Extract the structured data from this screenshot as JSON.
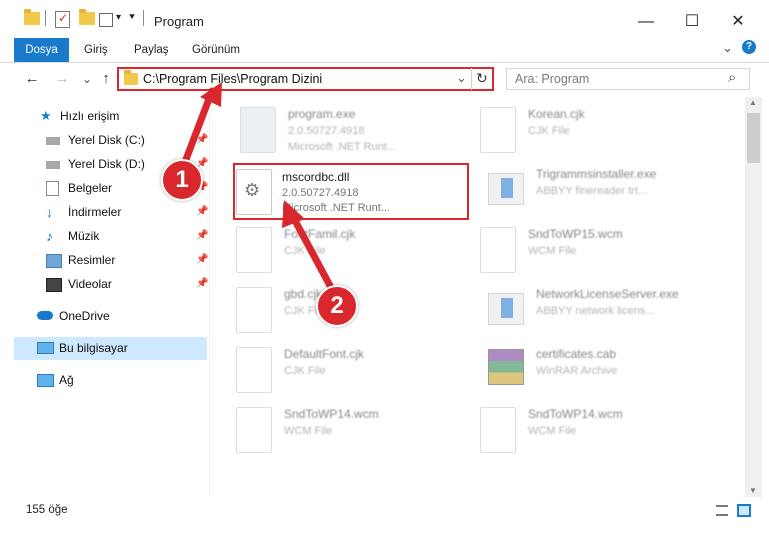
{
  "window": {
    "title": "Program",
    "minimize": "—",
    "maximize": "☐",
    "close": "✕"
  },
  "ribbon": {
    "tabs": [
      "Dosya",
      "Giriş",
      "Paylaş",
      "Görünüm"
    ],
    "expand": "⌄",
    "help": "?"
  },
  "nav": {
    "back": "←",
    "forward": "→",
    "recent": "⌄",
    "up": "↑",
    "address": "C:\\Program Files\\Program Dizini",
    "dropdown": "⌄",
    "refresh": "↻",
    "search_placeholder": "Ara: Program",
    "search_icon": "⌕"
  },
  "sidebar": {
    "quick_access": "Hızlı erişim",
    "items": [
      {
        "label": "Yerel Disk (C:)",
        "icon": "drive-icon",
        "pinned": true
      },
      {
        "label": "Yerel Disk (D:)",
        "icon": "drive-icon",
        "pinned": true
      },
      {
        "label": "Belgeler",
        "icon": "documents-icon",
        "pinned": true
      },
      {
        "label": "İndirmeler",
        "icon": "download-icon",
        "pinned": true
      },
      {
        "label": "Müzik",
        "icon": "music-icon",
        "pinned": true
      },
      {
        "label": "Resimler",
        "icon": "pictures-icon",
        "pinned": true
      },
      {
        "label": "Videolar",
        "icon": "videos-icon",
        "pinned": true
      }
    ],
    "onedrive": "OneDrive",
    "this_pc": "Bu bilgisayar",
    "network": "Ağ"
  },
  "files": [
    {
      "name": "program.exe",
      "line1": "2.0.50727.4918",
      "line2": "Microsoft .NET Runt...",
      "icon": "exe-icon"
    },
    {
      "name": "Korean.cjk",
      "line1": "CJK File",
      "line2": "",
      "icon": "file-icon"
    },
    {
      "name": "mscordbc.dll",
      "line1": "2.0.50727.4918",
      "line2": "Microsoft .NET Runt...",
      "icon": "dll-icon"
    },
    {
      "name": "Trigrammsinstaller.exe",
      "line1": "ABBYY finereader trt...",
      "line2": "",
      "icon": "exe-icon"
    },
    {
      "name": "FontFamil.cjk",
      "line1": "CJK File",
      "line2": "",
      "icon": "file-icon"
    },
    {
      "name": "SndToWP15.wcm",
      "line1": "WCM File",
      "line2": "",
      "icon": "file-icon"
    },
    {
      "name": "gbd.cjk",
      "line1": "CJK File",
      "line2": "",
      "icon": "file-icon"
    },
    {
      "name": "NetworkLicenseServer.exe",
      "line1": "ABBYY network licens...",
      "line2": "",
      "icon": "exe-icon"
    },
    {
      "name": "DefaultFont.cjk",
      "line1": "CJK File",
      "line2": "",
      "icon": "file-icon"
    },
    {
      "name": "certificates.cab",
      "line1": "WinRAR Archive",
      "line2": "",
      "icon": "archive-icon"
    },
    {
      "name": "SndToWP14.wcm",
      "line1": "WCM File",
      "line2": "",
      "icon": "file-icon"
    },
    {
      "name": "SndToWP14.wcm",
      "line1": "WCM File",
      "line2": "",
      "icon": "file-icon"
    }
  ],
  "status": {
    "count": "155 öğe"
  },
  "annotations": {
    "step1": "1",
    "step2": "2"
  },
  "colors": {
    "accent": "#1979ca",
    "highlight": "#d9272e",
    "selection": "#cde8ff"
  }
}
